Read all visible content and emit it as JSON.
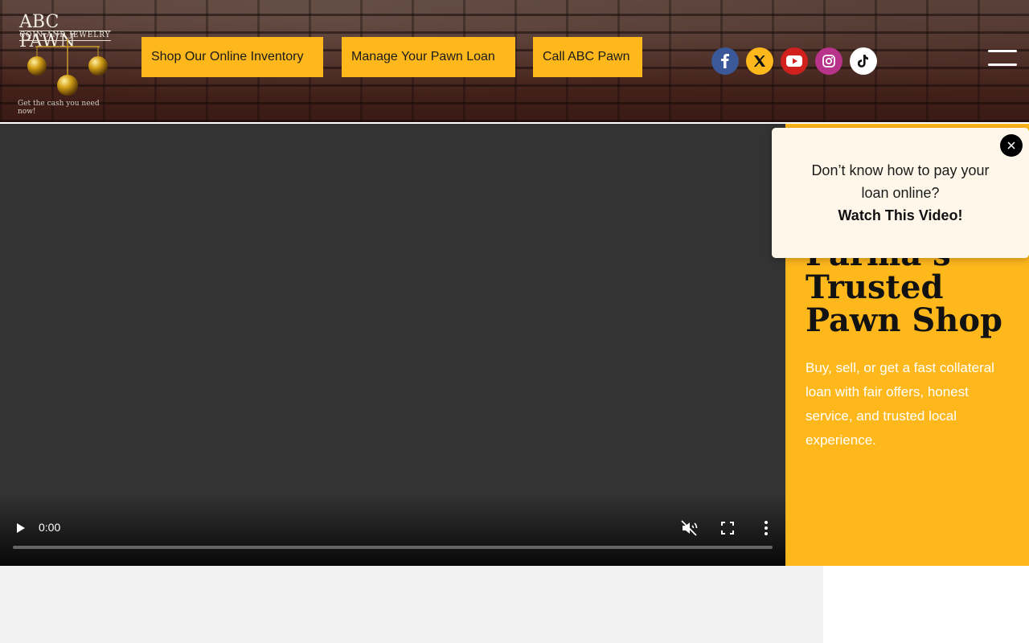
{
  "header": {
    "logo": {
      "title": "ABC PAWN",
      "subtitle": "COIN AND JEWELRY",
      "tagline": "Get the cash you need now!"
    },
    "nav": [
      {
        "label": "Shop Our Online Inventory"
      },
      {
        "label": "Manage Your Pawn Loan"
      },
      {
        "label": "Call ABC Pawn"
      }
    ],
    "social": [
      {
        "icon": "facebook-icon",
        "color": "#3b5998"
      },
      {
        "icon": "x-twitter-icon",
        "color": "#ffb81c"
      },
      {
        "icon": "youtube-icon",
        "color": "#d2201f"
      },
      {
        "icon": "instagram-icon",
        "color": "#b8338a"
      },
      {
        "icon": "tiktok-icon",
        "color": "#ffffff"
      }
    ],
    "menu_icon": "hamburger-menu-icon"
  },
  "video": {
    "current_time": "0:00",
    "controls": [
      "play-icon",
      "mute-icon",
      "fullscreen-icon",
      "more-options-icon"
    ]
  },
  "hero": {
    "title": "Parma’s Trusted Pawn Shop",
    "description": "Buy, sell, or get a fast collateral loan with fair offers, honest service, and trusted local experience."
  },
  "popup": {
    "text": "Don’t know how to pay your loan online?",
    "link": "Watch This Video!"
  },
  "colors": {
    "accent": "#ffb81c",
    "video_bg": "#333333",
    "popup_bg": "#fff8ea"
  }
}
